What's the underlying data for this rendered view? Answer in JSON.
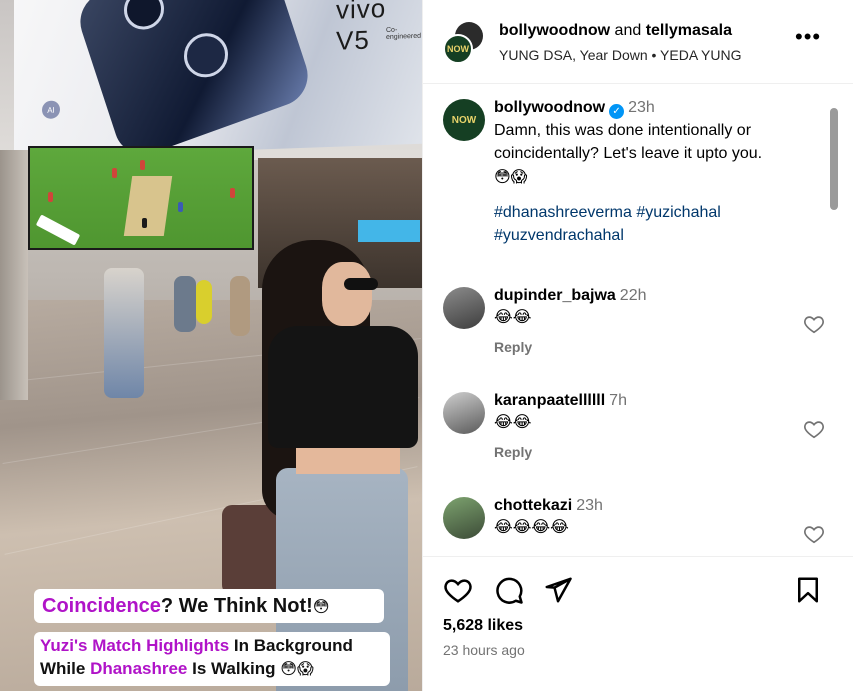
{
  "media": {
    "billboard_brand": "vivo V5",
    "billboard_sub": "Co-engineered",
    "ai_badge": "AI",
    "caption_line1_highlight": "Coincidence",
    "caption_line1_rest": "? We Think Not!",
    "caption_line1_emoji": "😳",
    "caption_line2_part1": "Yuzi's Match Highlights",
    "caption_line2_part2": " In Background",
    "caption_line3_part1": "While ",
    "caption_line3_part2": "Dhanashree",
    "caption_line3_part3": " Is Walking ",
    "caption_line3_emoji": "😳😱"
  },
  "header": {
    "author": "bollywoodnow",
    "joiner": "and",
    "collaborator": "tellymasala",
    "audio": "YUNG DSA, Year Down • YEDA YUNG",
    "avatar_text": "NOW",
    "more_icon": "more-horizontal-icon"
  },
  "post": {
    "username": "bollywoodnow",
    "time": "23h",
    "caption": "Damn, this was done intentionally or coincidentally? Let's leave it upto you.",
    "emoji": "😳😱",
    "hashtags_line1": "#dhanashreeverma #yuzichahal",
    "hashtags_line2": "#yuzvendrachahal"
  },
  "comments": [
    {
      "username": "dupinder_bajwa",
      "time": "22h",
      "emoji": "😂😂",
      "reply_label": "Reply"
    },
    {
      "username": "karanpaatellllll",
      "time": "7h",
      "emoji": "😂😂",
      "reply_label": "Reply"
    },
    {
      "username": "chottekazi",
      "time": "23h",
      "emoji": "😂😂😂😂"
    }
  ],
  "footer": {
    "likes": "5,628 likes",
    "posted": "23 hours ago"
  },
  "colors": {
    "caption_accent": "#b013c8",
    "hashtag": "#00376b",
    "verified": "#0095f6",
    "secondary_text": "#737373"
  }
}
